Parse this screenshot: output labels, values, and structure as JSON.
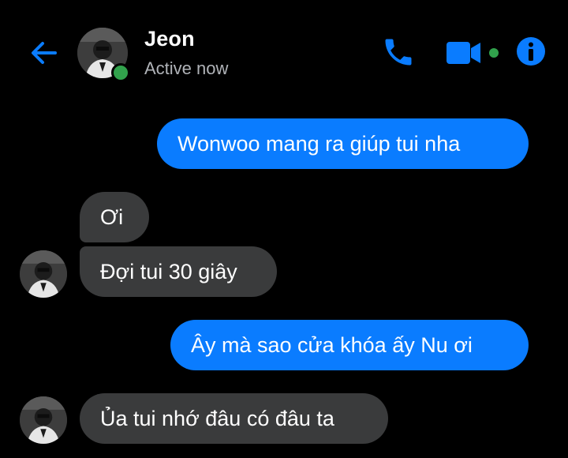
{
  "header": {
    "contact_name": "Jeon",
    "status": "Active now",
    "icons": {
      "back": "back-arrow-icon",
      "call": "phone-icon",
      "video": "video-camera-icon",
      "info": "info-icon"
    }
  },
  "messages": [
    {
      "direction": "outgoing",
      "text": "Wonwoo mang ra giúp tui nha"
    },
    {
      "direction": "incoming",
      "text": "Ơi"
    },
    {
      "direction": "incoming",
      "text": "Đợi tui 30 giây"
    },
    {
      "direction": "outgoing",
      "text": "Ây mà sao cửa khóa ấy Nu ơi"
    },
    {
      "direction": "incoming",
      "text": "Ủa tui nhớ đâu có đâu ta"
    }
  ],
  "colors": {
    "background": "#000000",
    "accent": "#0a7cff",
    "outgoing_bubble": "#0a7cff",
    "incoming_bubble": "#3a3b3c",
    "active_green": "#31a24c",
    "secondary_text": "#b0b3b8"
  }
}
